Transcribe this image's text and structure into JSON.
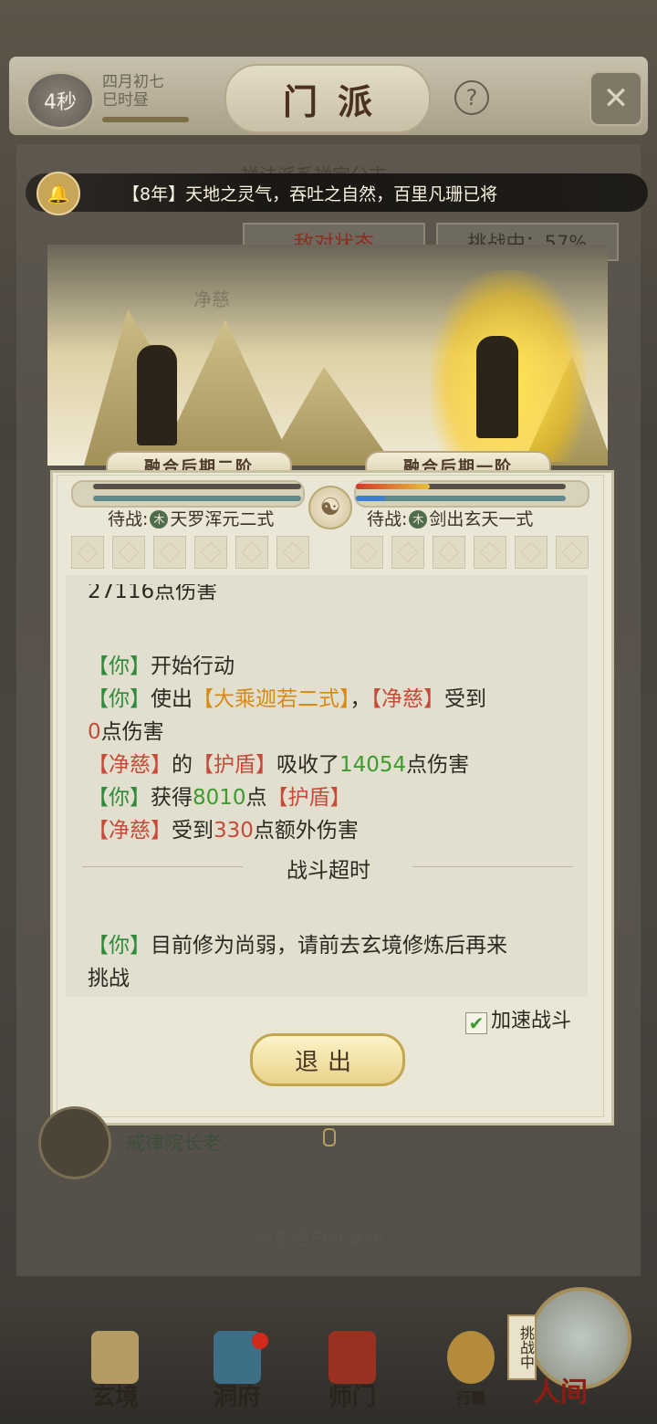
{
  "header": {
    "timer": "4秒",
    "date_line1": "四月初七",
    "date_line2": "巳时昼",
    "title": "门派",
    "help_icon": "?",
    "close_icon": "✕"
  },
  "marquee": {
    "text": "【8年】天地之灵气，吞吐之自然，百里凡珊已将"
  },
  "background_panel": {
    "sect_desc": "禅法派系禅宗分支",
    "hostile_label": "敌对状态",
    "challenge_label": "挑战中：57%"
  },
  "battle": {
    "player_rank": "融合后期二阶",
    "enemy_rank": "融合后期一阶",
    "enemy_name": "净慈",
    "player_hp_fraction": 1.0,
    "enemy_hp_fraction": 0.35,
    "player_wait_prefix": "待战:",
    "player_element": "木",
    "player_skill": "天罗浑元二式",
    "enemy_wait_prefix": "待战:",
    "enemy_element": "木",
    "enemy_skill": "剑出玄天一式"
  },
  "log": {
    "partial_line": "27116点伤害",
    "l1_tag": "【你】",
    "l1_text": "开始行动",
    "l2_tag": "【你】",
    "l2_text": "使出",
    "l2_skill": "【大乘迦若二式】",
    "l2_comma": "，",
    "l2_target": "【净慈】",
    "l2_suffix": "受到",
    "l3_num": "0",
    "l3_text": "点伤害",
    "l4_tag": "【净慈】",
    "l4_de": "的",
    "l4_shield": "【护盾】",
    "l4_absorb": "吸收了",
    "l4_num": "14054",
    "l4_end": "点伤害",
    "l5_tag": "【你】",
    "l5_get": "获得",
    "l5_num": "8010",
    "l5_dian": "点",
    "l5_shield": "【护盾】",
    "l6_tag": "【净慈】",
    "l6_text": "受到",
    "l6_num": "330",
    "l6_end": "点额外伤害",
    "timeout": "战斗超时",
    "l7_tag": "【你】",
    "l7_text": "目前修为尚弱，请前去玄境修炼后再来",
    "l8_text": "挑战"
  },
  "controls": {
    "speed_label": "加速战斗",
    "speed_checked": true,
    "exit_label": "退出"
  },
  "under_content": {
    "elder_label": "戒律院长老",
    "return_hint": "点击空白处返回"
  },
  "nav": {
    "items": [
      "玄境",
      "洞府",
      "师门",
      "行囊"
    ],
    "world": "人间",
    "challenge_tag": "挑战中"
  }
}
